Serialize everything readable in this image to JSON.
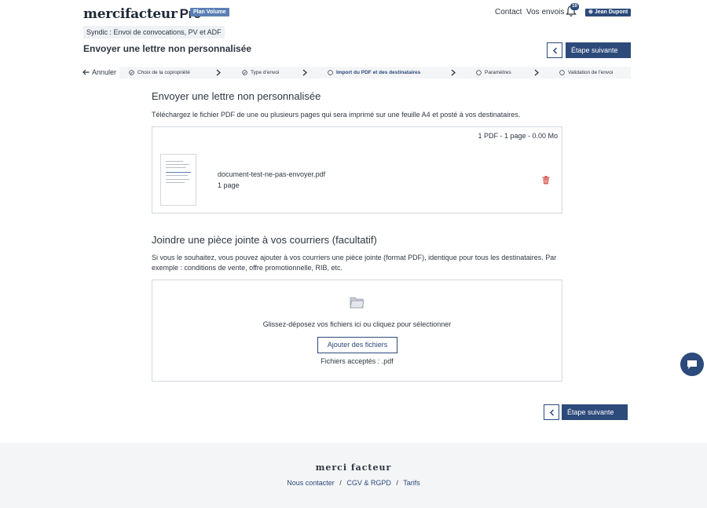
{
  "header": {
    "logo_main": "mercifacteur",
    "logo_pro": "Pro",
    "plan_badge": "Plan Volume",
    "contact_label": "Contact",
    "envois_label": "Vos envois",
    "notification_count": "10",
    "user_name": "Jean Dupont"
  },
  "breadcrumb": "Syndic : Envoi de convocations, PV et ADF",
  "page_title": "Envoyer une lettre non personnalisée",
  "nav": {
    "next_label": "Étape suivante",
    "cancel_label": "Annuler"
  },
  "steps": [
    {
      "label": "Choix de la copropriété",
      "state": "done"
    },
    {
      "label": "Type d'envoi",
      "state": "done"
    },
    {
      "label": "Import du PDF et des destinataires",
      "state": "active"
    },
    {
      "label": "Paramètres",
      "state": "todo"
    },
    {
      "label": "Validation de l'envoi",
      "state": "todo"
    }
  ],
  "main_section": {
    "title": "Envoyer une lettre non personnalisée",
    "description": "Téléchargez le fichier PDF de une ou plusieurs pages qui sera imprimé sur une feuille A4 et posté à vos destinataires.",
    "stats": "1 PDF - 1 page - 0.00 Mo",
    "file_name": "document-test-ne-pas-envoyer.pdf",
    "file_pages": "1 page"
  },
  "attachment_section": {
    "title": "Joindre une pièce jointe à vos courriers (facultatif)",
    "description": "Si vous le souhaitez, vous pouvez ajouter à vos courriers une pièce jointe (format PDF), identique pour tous les destinataires. Par exemple : conditions de vente, offre promotionnelle, RIB, etc.",
    "drop_text": "Glissez-déposez vos fichiers ici ou cliquez pour sélectionner",
    "add_button": "Ajouter des fichiers",
    "accepted": "Fichiers acceptés : .pdf"
  },
  "footer": {
    "logo": "merci facteur",
    "links": [
      "Nous contacter",
      "CGV & RGPD",
      "Tarifs"
    ],
    "separator": "/"
  },
  "colors": {
    "primary": "#2c4a7a",
    "badge": "#5b7fb5",
    "text": "#2f3640",
    "border": "#d3d7de",
    "footer_bg": "#f4f5f7",
    "trash": "#d9534f"
  },
  "icons": [
    "bell-icon",
    "user-icon",
    "chevron-left-icon",
    "chevron-right-icon",
    "arrow-left-icon",
    "check-circle-icon",
    "circle-icon",
    "trash-icon",
    "folder-icon",
    "chat-icon"
  ]
}
